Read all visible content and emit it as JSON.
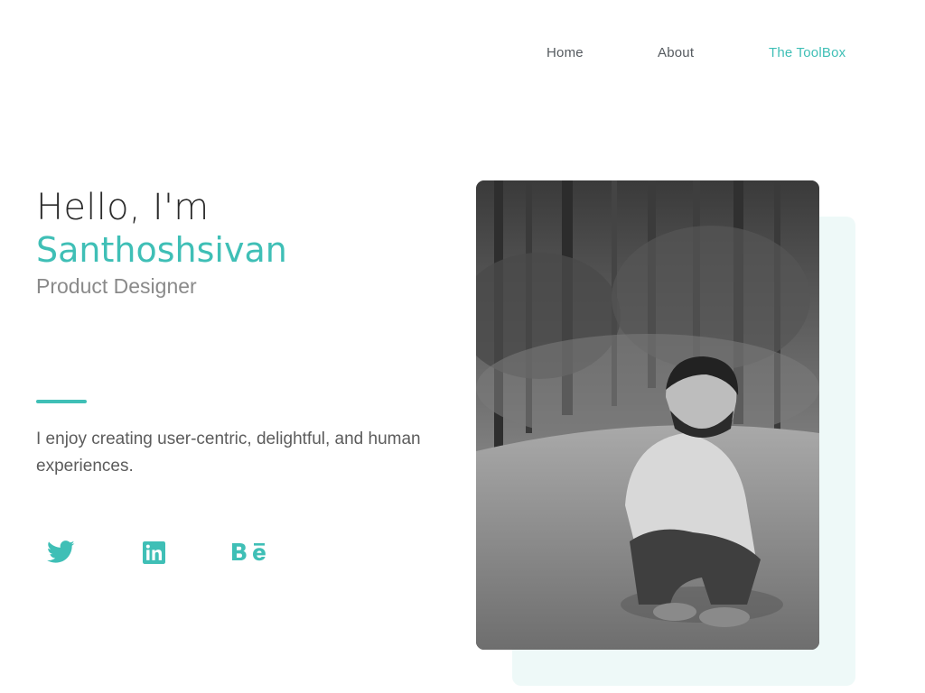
{
  "nav": {
    "items": [
      {
        "label": "Home",
        "active": false
      },
      {
        "label": "About",
        "active": false
      },
      {
        "label": "The ToolBox",
        "active": true
      }
    ]
  },
  "hero": {
    "greeting": "Hello, I'm",
    "name": "Santhoshsivan",
    "role": "Product Designer",
    "bio": "I enjoy creating user-centric, delightful, and human experiences."
  },
  "social": {
    "items": [
      {
        "icon": "twitter-icon"
      },
      {
        "icon": "linkedin-icon"
      },
      {
        "icon": "behance-icon"
      }
    ]
  },
  "photo": {
    "subject": "portrait-photo"
  },
  "colors": {
    "accent": "#3fbfb6",
    "text_dark": "#2b2b2b",
    "text_muted": "#8a8a8a",
    "photo_backdrop": "#eef9f8"
  }
}
